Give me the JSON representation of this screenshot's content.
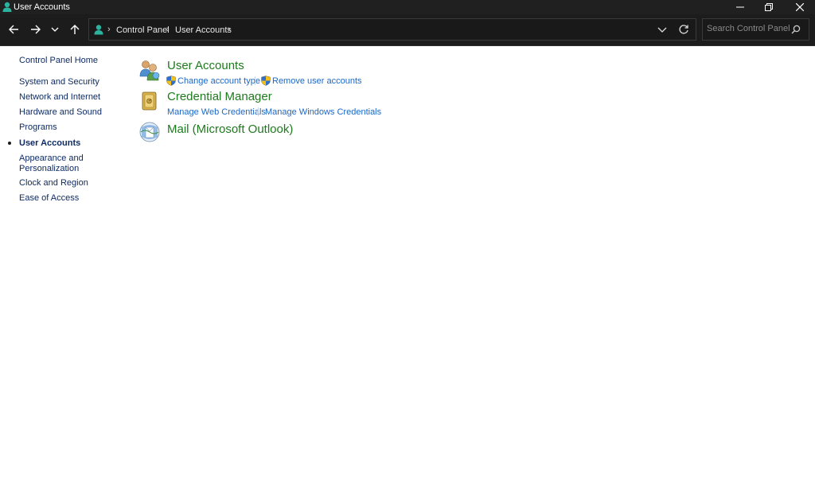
{
  "window": {
    "title": "User Accounts"
  },
  "toolbar": {
    "back_icon": "arrow-left-icon",
    "forward_icon": "arrow-right-icon",
    "recent_icon": "chevron-down-icon",
    "up_icon": "arrow-up-icon",
    "refresh_icon": "refresh-icon"
  },
  "breadcrumb": {
    "items": [
      "Control Panel",
      "User Accounts"
    ]
  },
  "search": {
    "placeholder": "Search Control Panel",
    "value": ""
  },
  "sidebar": {
    "home": "Control Panel Home",
    "items": [
      {
        "label": "System and Security"
      },
      {
        "label": "Network and Internet"
      },
      {
        "label": "Hardware and Sound"
      },
      {
        "label": "Programs"
      },
      {
        "label": "User Accounts",
        "active": true
      },
      {
        "label": "Appearance and\nPersonalization"
      },
      {
        "label": "Clock and Region"
      },
      {
        "label": "Ease of Access"
      }
    ]
  },
  "categories": [
    {
      "title": "User Accounts",
      "icon": "users-icon",
      "links": [
        "Change account type",
        "Remove user accounts"
      ]
    },
    {
      "title": "Credential Manager",
      "icon": "credential-vault-icon",
      "links": [
        "Manage Web Credentials",
        "Manage Windows Credentials"
      ]
    },
    {
      "title": "Mail (Microsoft Outlook)",
      "icon": "mail-icon",
      "links": []
    }
  ],
  "colors": {
    "title_bar": "#202020",
    "category_title": "#1e7a1e",
    "link": "#1b67c7",
    "sidebar_link": "#0f2b63"
  }
}
